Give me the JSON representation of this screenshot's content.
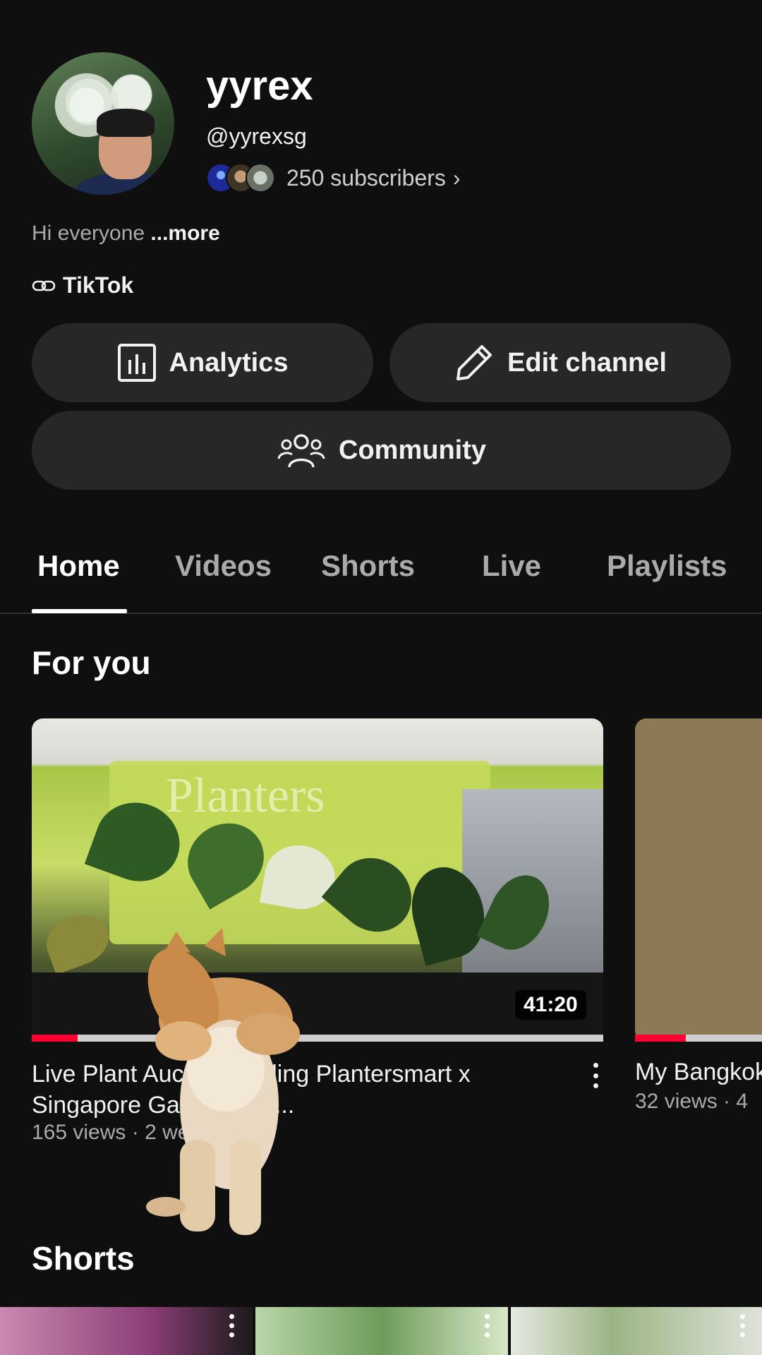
{
  "channel": {
    "name": "yyrex",
    "handle": "@yyrexsg",
    "subscribers": "250 subscribers",
    "bio": "Hi everyone",
    "bio_more": "...more",
    "link": "TikTok"
  },
  "buttons": {
    "analytics": "Analytics",
    "edit_channel": "Edit channel",
    "community": "Community"
  },
  "tabs": [
    "Home",
    "Videos",
    "Shorts",
    "Live",
    "Playlists"
  ],
  "active_tab": "Home",
  "sections": {
    "for_you": "For you",
    "shorts": "Shorts"
  },
  "videos": [
    {
      "title": "Live Plant Auction Bidding Plantersmart x Singapore Garden Fes...",
      "meta": "165 views · 2 weeks ago",
      "duration": "41:20",
      "watched_fraction": 0.08
    },
    {
      "title": "My Bangkok",
      "meta": "32 views · 4",
      "watched_fraction": 0.4
    }
  ],
  "colors": {
    "background": "#0f0f0f",
    "pill": "#272727",
    "progress": "#ff0033",
    "muted_text": "#aaaaaa"
  },
  "icons": {
    "analytics": "bar-chart-icon",
    "edit": "pencil-icon",
    "community": "people-icon",
    "link": "link-icon",
    "more": "vertical-dots-icon"
  }
}
